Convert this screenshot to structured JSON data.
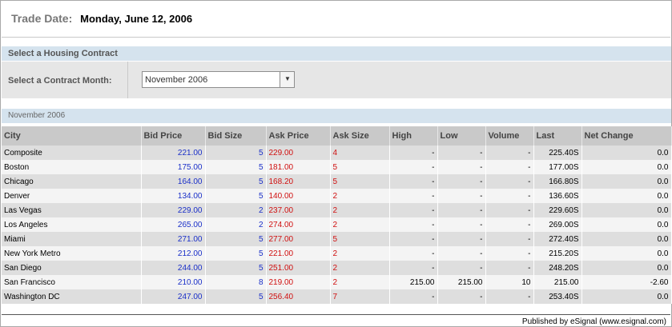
{
  "header": {
    "trade_date_label": "Trade Date:",
    "trade_date_value": "Monday, June 12, 2006"
  },
  "contract_section": {
    "title": "Select a Housing Contract",
    "month_label": "Select a Contract Month:",
    "month_selected": "November 2006",
    "dropdown_icon": "chevron-down-icon"
  },
  "table_section": {
    "title": "November 2006"
  },
  "table": {
    "columns": [
      "City",
      "Bid Price",
      "Bid Size",
      "Ask Price",
      "Ask Size",
      "High",
      "Low",
      "Volume",
      "Last",
      "Net Change"
    ],
    "rows": [
      [
        "Composite",
        "221.00",
        "5",
        "229.00",
        "4",
        "-",
        "-",
        "-",
        "225.40S",
        "0.0"
      ],
      [
        "Boston",
        "175.00",
        "5",
        "181.00",
        "5",
        "-",
        "-",
        "-",
        "177.00S",
        "0.0"
      ],
      [
        "Chicago",
        "164.00",
        "5",
        "168.20",
        "5",
        "-",
        "-",
        "-",
        "166.80S",
        "0.0"
      ],
      [
        "Denver",
        "134.00",
        "5",
        "140.00",
        "2",
        "-",
        "-",
        "-",
        "136.60S",
        "0.0"
      ],
      [
        "Las Vegas",
        "229.00",
        "2",
        "237.00",
        "2",
        "-",
        "-",
        "-",
        "229.60S",
        "0.0"
      ],
      [
        "Los Angeles",
        "265.00",
        "2",
        "274.00",
        "2",
        "-",
        "-",
        "-",
        "269.00S",
        "0.0"
      ],
      [
        "Miami",
        "271.00",
        "5",
        "277.00",
        "5",
        "-",
        "-",
        "-",
        "272.40S",
        "0.0"
      ],
      [
        "New York Metro",
        "212.00",
        "5",
        "221.00",
        "2",
        "-",
        "-",
        "-",
        "215.20S",
        "0.0"
      ],
      [
        "San Diego",
        "244.00",
        "5",
        "251.00",
        "2",
        "-",
        "-",
        "-",
        "248.20S",
        "0.0"
      ],
      [
        "San Francisco",
        "210.00",
        "8",
        "219.00",
        "2",
        "215.00",
        "215.00",
        "10",
        "215.00",
        "-2.60"
      ],
      [
        "Washington DC",
        "247.00",
        "5",
        "256.40",
        "7",
        "-",
        "-",
        "-",
        "253.40S",
        "0.0"
      ]
    ]
  },
  "footer": {
    "published": "Published by eSignal (www.esignal.com)"
  },
  "colors": {
    "bid": "#1a2fc8",
    "ask": "#d01010",
    "section_bar": "#d5e3ee",
    "header_row": "#c9c9c9"
  }
}
